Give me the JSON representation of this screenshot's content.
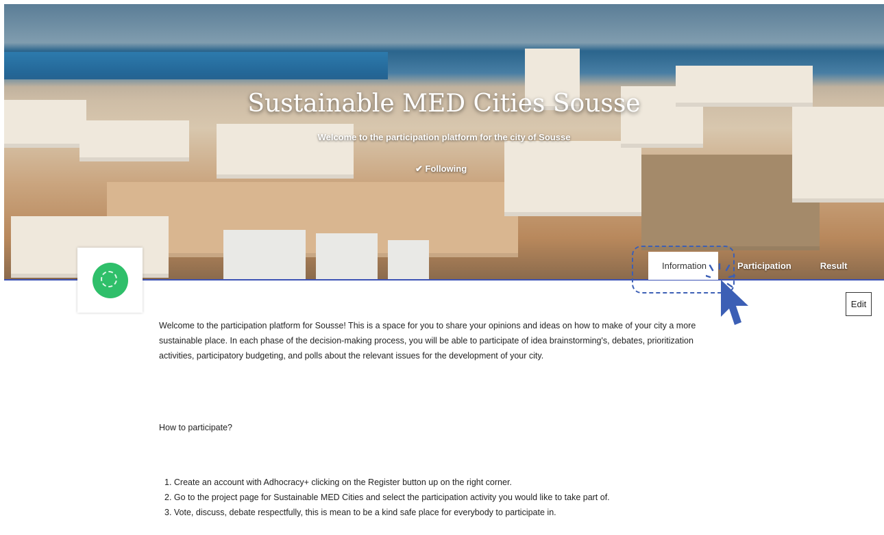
{
  "hero": {
    "title": "Sustainable MED Cities Sousse",
    "subtitle": "Welcome to the participation platform for the city of Sousse",
    "follow_label": "✔ Following"
  },
  "tabs": [
    {
      "label": "Information",
      "active": true
    },
    {
      "label": "Participation",
      "active": false
    },
    {
      "label": "Result",
      "active": false
    }
  ],
  "actions": {
    "edit_label": "Edit"
  },
  "content": {
    "intro": "Welcome to the participation platform for Sousse! This is a space for you to share your opinions and ideas on how to make of your city a more sustainable place. In each phase of the decision-making process, you will be able to participate of idea brainstorming's, debates, prioritization activities, participatory budgeting, and polls about the relevant issues for the development of your city.",
    "how_heading": "How to participate?",
    "steps": [
      "1. Create an account with Adhocracy+ clicking on the Register button up on the right corner.",
      "2. Go to the project page for Sustainable MED Cities and select the participation activity you would like to take part of.",
      "3. Vote, discuss, debate respectfully, this is mean to be a kind safe place for everybody to participate in."
    ]
  },
  "colors": {
    "accent": "#3c52b5",
    "logo_green": "#2fbf6a",
    "highlight": "#3c5fb5"
  }
}
